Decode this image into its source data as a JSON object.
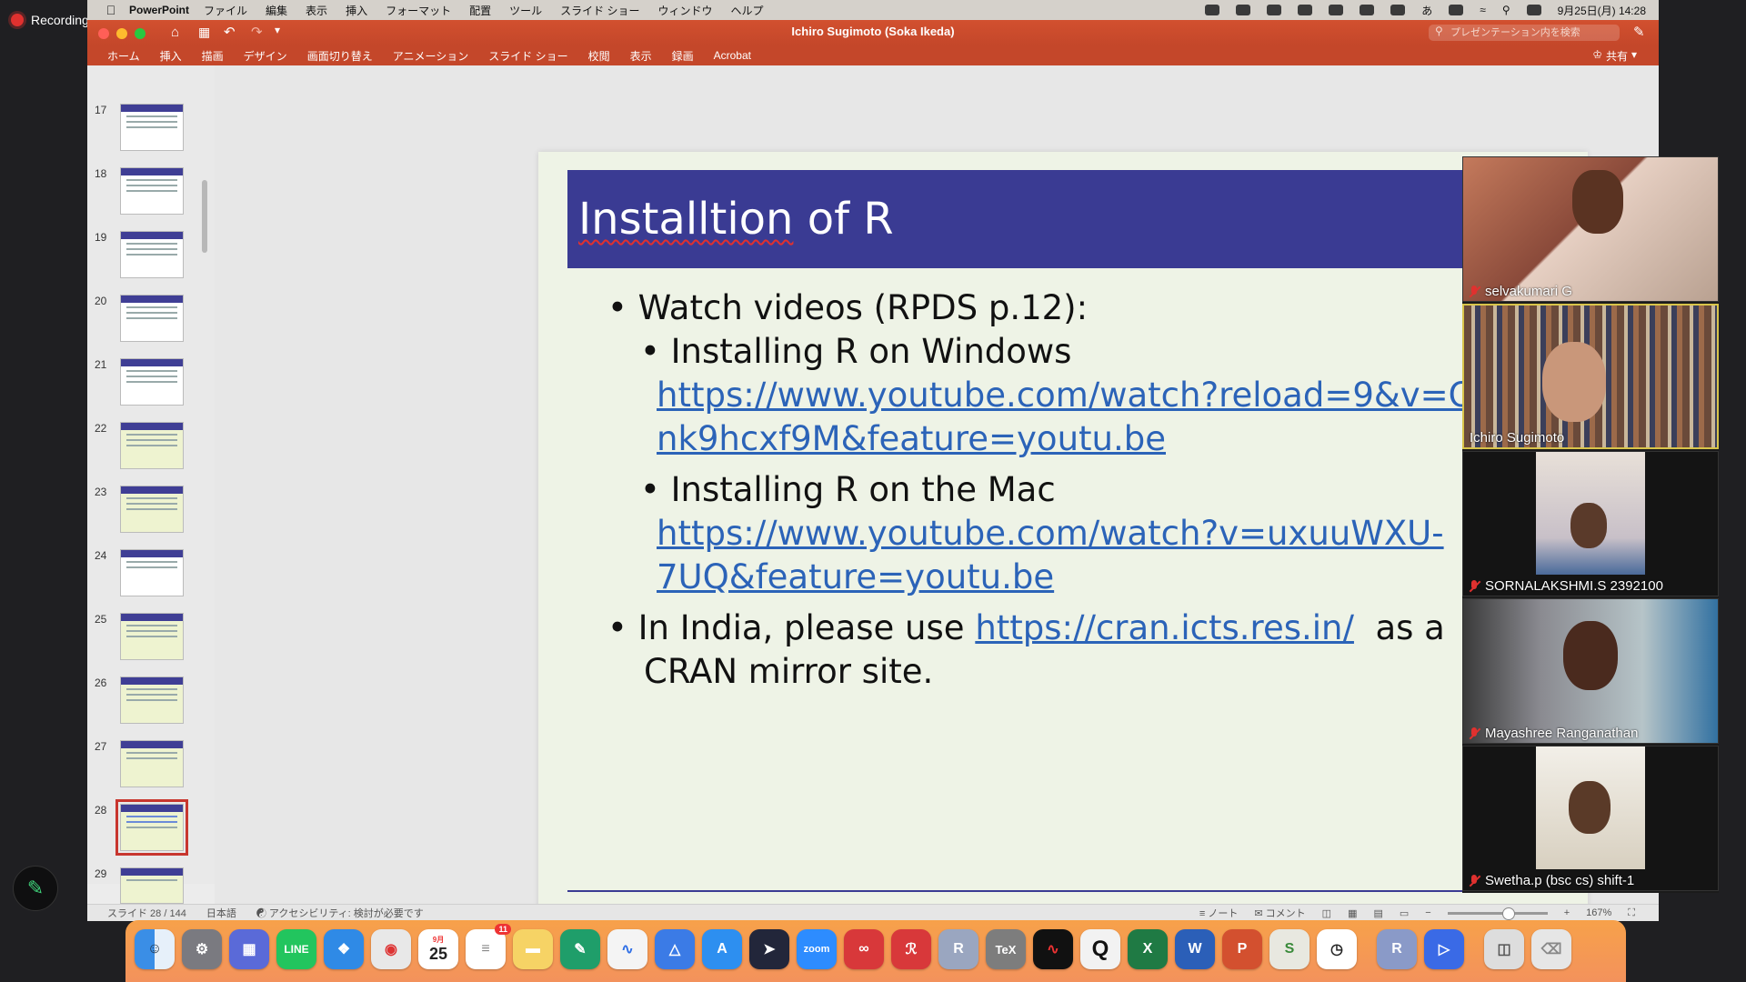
{
  "recording": {
    "label": "Recording"
  },
  "menubar": {
    "app_name": "PowerPoint",
    "items": [
      "ファイル",
      "編集",
      "表示",
      "挿入",
      "フォーマット",
      "配置",
      "ツール",
      "スライド ショー",
      "ウィンドウ",
      "ヘルプ"
    ],
    "clock": "9月25日(月) 14:28",
    "ime": "あ"
  },
  "window": {
    "title": "Ichiro Sugimoto (Soka Ikeda)",
    "search_placeholder": "プレゼンテーション内を検索",
    "share_label": "共有",
    "ribbon_tabs": [
      "ホーム",
      "挿入",
      "描画",
      "デザイン",
      "画面切り替え",
      "アニメーション",
      "スライド ショー",
      "校閲",
      "表示",
      "録画",
      "Acrobat"
    ]
  },
  "thumbnails": {
    "numbers": [
      "17",
      "18",
      "19",
      "20",
      "21",
      "22",
      "23",
      "24",
      "25",
      "26",
      "27",
      "28",
      "29"
    ],
    "selected": "28"
  },
  "slide": {
    "title_misspelled": "Installtion",
    "title_rest": " of R",
    "bullet1": "Watch videos (RPDS p.12):",
    "sub1_label": "Installing R on Windows",
    "sub1_link_line1": "https://www.youtube.com/watch?reload=9&v=Oh",
    "sub1_link_line2": "nk9hcxf9M&feature=youtu.be",
    "sub2_label": "Installing R on the Mac",
    "sub2_link_line1": "https://www.youtube.com/watch?v=uxuuWXU-",
    "sub2_link_line2": "7UQ&feature=youtu.be",
    "bullet2_prefix": "In India, please use ",
    "bullet2_link": "https://cran.icts.res.in/",
    "bullet2_suffix": "  as a",
    "bullet2_line2": "CRAN mirror site."
  },
  "statusbar": {
    "slide_counter": "スライド 28 / 144",
    "language": "日本語",
    "accessibility": "アクセシビリティ: 検討が必要です",
    "notes": "ノート",
    "comments": "コメント",
    "zoom": "167%"
  },
  "participants": [
    {
      "name": "selvakumari G",
      "muted": true
    },
    {
      "name": "Ichiro Sugimoto",
      "muted": false
    },
    {
      "name": "SORNALAKSHMI.S 2392100",
      "muted": true
    },
    {
      "name": "Mayashree Ranganathan",
      "muted": true
    },
    {
      "name": "Swetha.p (bsc cs) shift-1",
      "muted": true
    }
  ],
  "dock": {
    "calendar_month": "9月",
    "calendar_day": "25",
    "reminders_badge": "11",
    "apps": [
      "Finder",
      "System Settings",
      "Launchpad",
      "LINE",
      "Safari",
      "Chrome",
      "Calendar",
      "Reminders",
      "Notes",
      "Xcode",
      "Freeform",
      "Keynote",
      "App Store",
      "Cursor",
      "Zoom",
      "Mendeley",
      "Acrobat",
      "R",
      "TeX",
      "Audio",
      "QuickTime",
      "Excel",
      "Word",
      "PowerPoint",
      "Scrivener",
      "Clock",
      "R",
      "Remote",
      "Preview",
      "Trash"
    ]
  },
  "colors": {
    "ppt_red": "#c4472a",
    "slide_header": "#3a3b93",
    "slide_bg": "#eef3e6",
    "link_blue": "#2b63b8",
    "dock_orange": "#f7a14a",
    "mute_red": "#e0312f"
  }
}
